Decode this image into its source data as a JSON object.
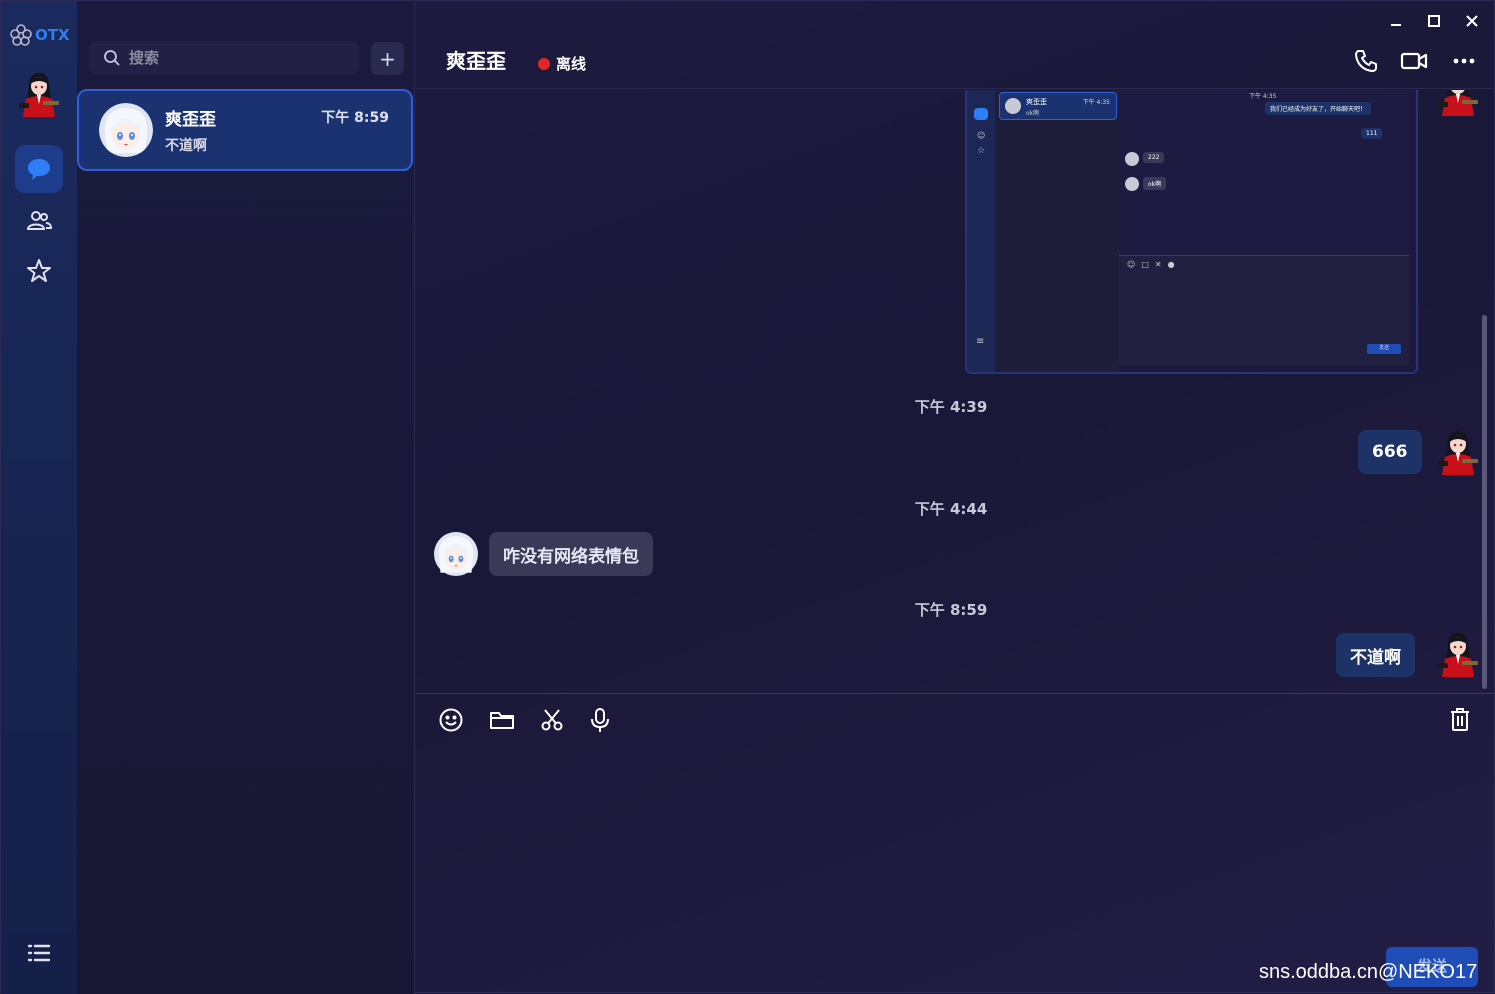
{
  "app": {
    "logo_text": "OTX"
  },
  "sidebar": {
    "items": [
      {
        "name": "chat",
        "icon": "chat-bubble-icon",
        "active": true
      },
      {
        "name": "contacts",
        "icon": "contacts-icon",
        "active": false
      },
      {
        "name": "favorites",
        "icon": "star-icon",
        "active": false
      }
    ],
    "menu_icon": "menu-list-icon"
  },
  "search": {
    "placeholder": "搜索"
  },
  "add_button_label": "+",
  "conversations": [
    {
      "name": "爽歪歪",
      "time": "下午 8:59",
      "last_message": "不道啊"
    }
  ],
  "chat": {
    "contact_name": "爽歪歪",
    "status": "离线",
    "status_color": "#e32626",
    "messages": [
      {
        "type": "image",
        "from": "me"
      },
      {
        "type": "timestamp",
        "text": "下午 4:39"
      },
      {
        "type": "text",
        "from": "me",
        "text": "666"
      },
      {
        "type": "timestamp",
        "text": "下午 4:44"
      },
      {
        "type": "text",
        "from": "them",
        "text": "咋没有网络表情包"
      },
      {
        "type": "timestamp",
        "text": "下午 8:59"
      },
      {
        "type": "text",
        "from": "me",
        "text": "不道啊"
      }
    ]
  },
  "embedded_screenshot": {
    "contact_name": "爽歪歪",
    "contact_sub": "ok啊",
    "contact_time": "下午 4:35",
    "time": "下午 4:35",
    "msg1": "我们已经成为好友了，开始聊天吧！",
    "msg2": "111",
    "msg3": "222",
    "msg4": "ok啊",
    "send": "发送"
  },
  "composer": {
    "send_label": "发送"
  },
  "watermark": "sns.oddba.cn@NEKO17",
  "colors": {
    "accent": "#2f5ed8",
    "my_bubble": "#1d3266",
    "their_bubble": "#3a3a58"
  }
}
